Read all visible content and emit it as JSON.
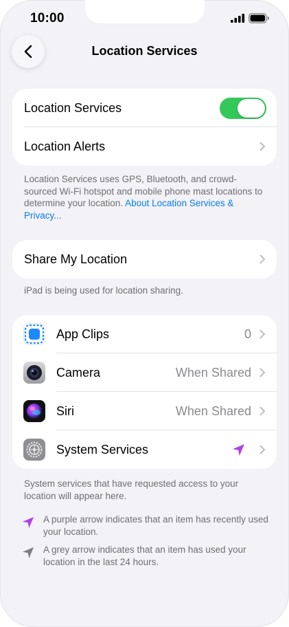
{
  "status_bar": {
    "time": "10:00"
  },
  "nav": {
    "title": "Location Services"
  },
  "group1": {
    "location_services_label": "Location Services",
    "location_services_on": true,
    "location_alerts_label": "Location Alerts"
  },
  "footnote1": {
    "text": "Location Services uses GPS, Bluetooth, and crowd-sourced Wi-Fi hotspot and mobile phone mast locations to determine your location.",
    "link": "About Location Services & Privacy..."
  },
  "group2": {
    "share_label": "Share My Location"
  },
  "footnote2": {
    "text": "iPad is being used for location sharing."
  },
  "apps": [
    {
      "name": "App Clips",
      "value": "0",
      "icon": "app-clips-icon"
    },
    {
      "name": "Camera",
      "value": "When Shared",
      "icon": "camera-icon"
    },
    {
      "name": "Siri",
      "value": "When Shared",
      "icon": "siri-icon"
    },
    {
      "name": "System Services",
      "value": "",
      "icon": "settings-gear-icon"
    }
  ],
  "footnote3": {
    "text": "System services that have requested access to your location will appear here."
  },
  "legend": {
    "purple": "A purple arrow indicates that an item has recently used your location.",
    "grey": "A grey arrow indicates that an item has used your location in the last 24 hours."
  },
  "colors": {
    "toggle_on": "#34c759",
    "link": "#0a7cf0",
    "purple_arrow": "#b043e0",
    "grey_arrow": "#7d7d82"
  }
}
